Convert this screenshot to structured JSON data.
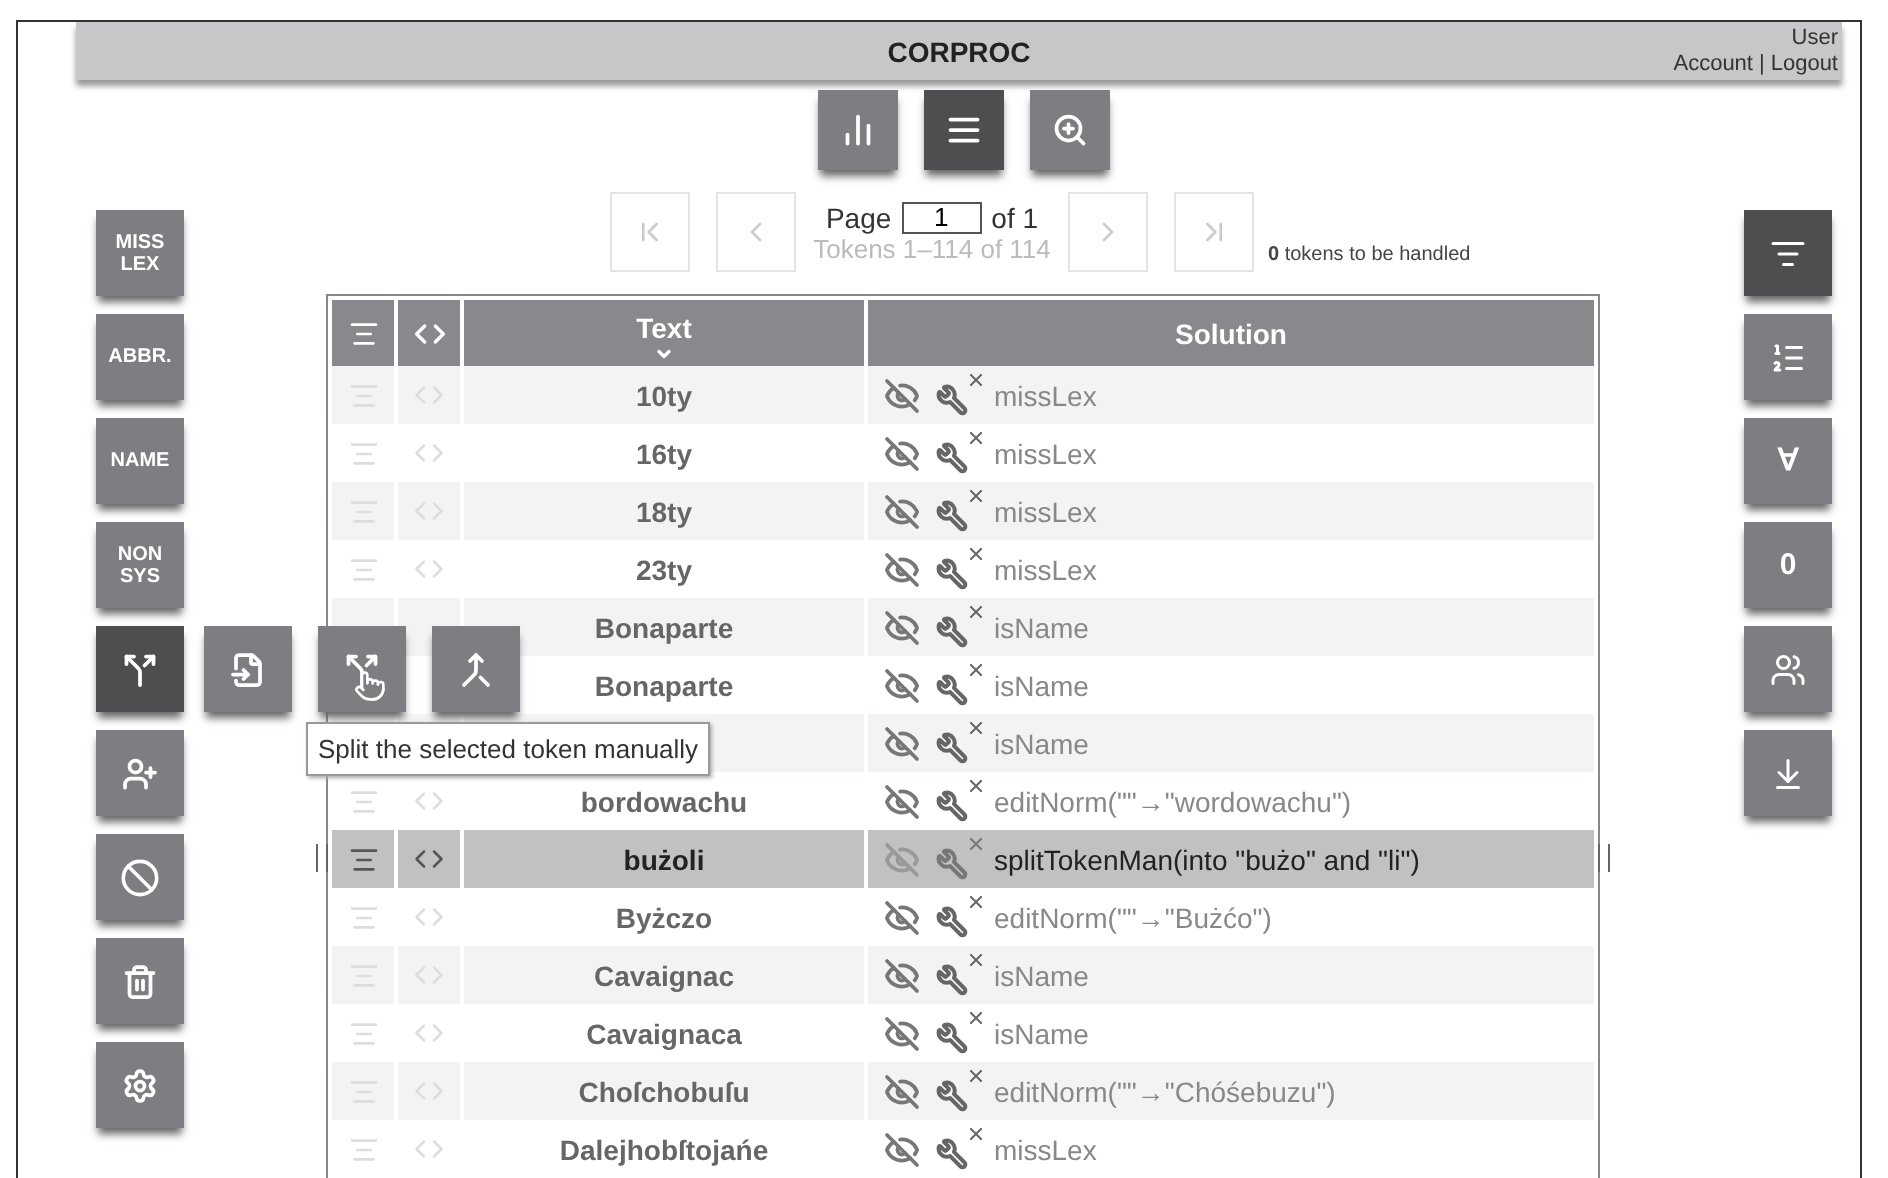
{
  "header": {
    "title": "CORPROC",
    "user": "User",
    "links": [
      "Account",
      "Logout"
    ],
    "separator": "|"
  },
  "view_buttons": [
    {
      "selected": false
    },
    {
      "selected": true
    },
    {
      "selected": false
    }
  ],
  "pager": {
    "page": "1",
    "of": "of 1",
    "label": "Page",
    "range": "Tokens 1–114 of 114",
    "pending": "**0** tokens to be handled",
    "disabled": true
  },
  "left_tools": [
    {
      "kind": "text",
      "label": "MISS LEX",
      "selected": false
    },
    {
      "kind": "text",
      "label": "ABBR.",
      "selected": false
    },
    {
      "kind": "text",
      "label": "NAME",
      "selected": false
    },
    {
      "kind": "text",
      "label": "NON SYS",
      "selected": false
    },
    {
      "kind": "icon",
      "selected": true,
      "expanded": true
    },
    {
      "kind": "icon",
      "selected": false
    },
    {
      "kind": "icon",
      "selected": false
    },
    {
      "kind": "icon",
      "selected": false
    },
    {
      "kind": "icon",
      "selected": false
    }
  ],
  "split_menu": [
    {
      "hovered": false
    },
    {
      "hovered": true
    },
    {
      "hovered": false
    }
  ],
  "tooltip": "Split the selected token manually",
  "right_tools": [
    {
      "kind": "icon",
      "selected": true
    },
    {
      "kind": "icon",
      "selected": false
    },
    {
      "kind": "text",
      "label": "∀",
      "selected": false
    },
    {
      "kind": "text",
      "label": "0",
      "selected": false
    },
    {
      "kind": "icon",
      "selected": false
    },
    {
      "kind": "icon",
      "selected": false
    }
  ],
  "table": {
    "columns": [
      {
        "label": "Text",
        "sorted": true
      },
      {
        "label": "Solution",
        "sorted": false
      }
    ],
    "rows": [
      {
        "kind": "plain",
        "text": "10ty",
        "solution": "missLex",
        "selected": false
      },
      {
        "kind": "plain",
        "text": "16ty",
        "solution": "missLex",
        "selected": false
      },
      {
        "kind": "plain",
        "text": "18ty",
        "solution": "missLex",
        "selected": false
      },
      {
        "kind": "plain",
        "text": "23ty",
        "solution": "missLex",
        "selected": false
      },
      {
        "kind": "overlaid",
        "text": "Bonaparte",
        "solution": "isName",
        "selected": false
      },
      {
        "kind": "overlaid",
        "text": "Bonaparte",
        "solution": "isName",
        "selected": false
      },
      {
        "kind": "overlaid",
        "solution": "isName",
        "selected": false
      },
      {
        "kind": "plain",
        "text": "bordowachu",
        "solution": "editNorm(\"\"→\"wordowachu\")",
        "selected": false
      },
      {
        "kind": "plain",
        "text": "bużoli",
        "solution": "splitTokenMan(into \"bużo\" and \"li\")",
        "selected": true
      },
      {
        "kind": "plain",
        "text": "Byżczo",
        "solution": "editNorm(\"\"→\"Bużćo\")",
        "selected": false
      },
      {
        "kind": "plain",
        "text": "Cavaignac",
        "solution": "isName",
        "selected": false
      },
      {
        "kind": "plain",
        "text": "Cavaignaca",
        "solution": "isName",
        "selected": false
      },
      {
        "kind": "plain",
        "text": "Choſchobuſu",
        "solution": "editNorm(\"\"→\"Chóśebuzu\")",
        "selected": false
      },
      {
        "kind": "plain",
        "text": "Dalejhobſtojańe",
        "solution": "missLex",
        "selected": false
      }
    ]
  }
}
